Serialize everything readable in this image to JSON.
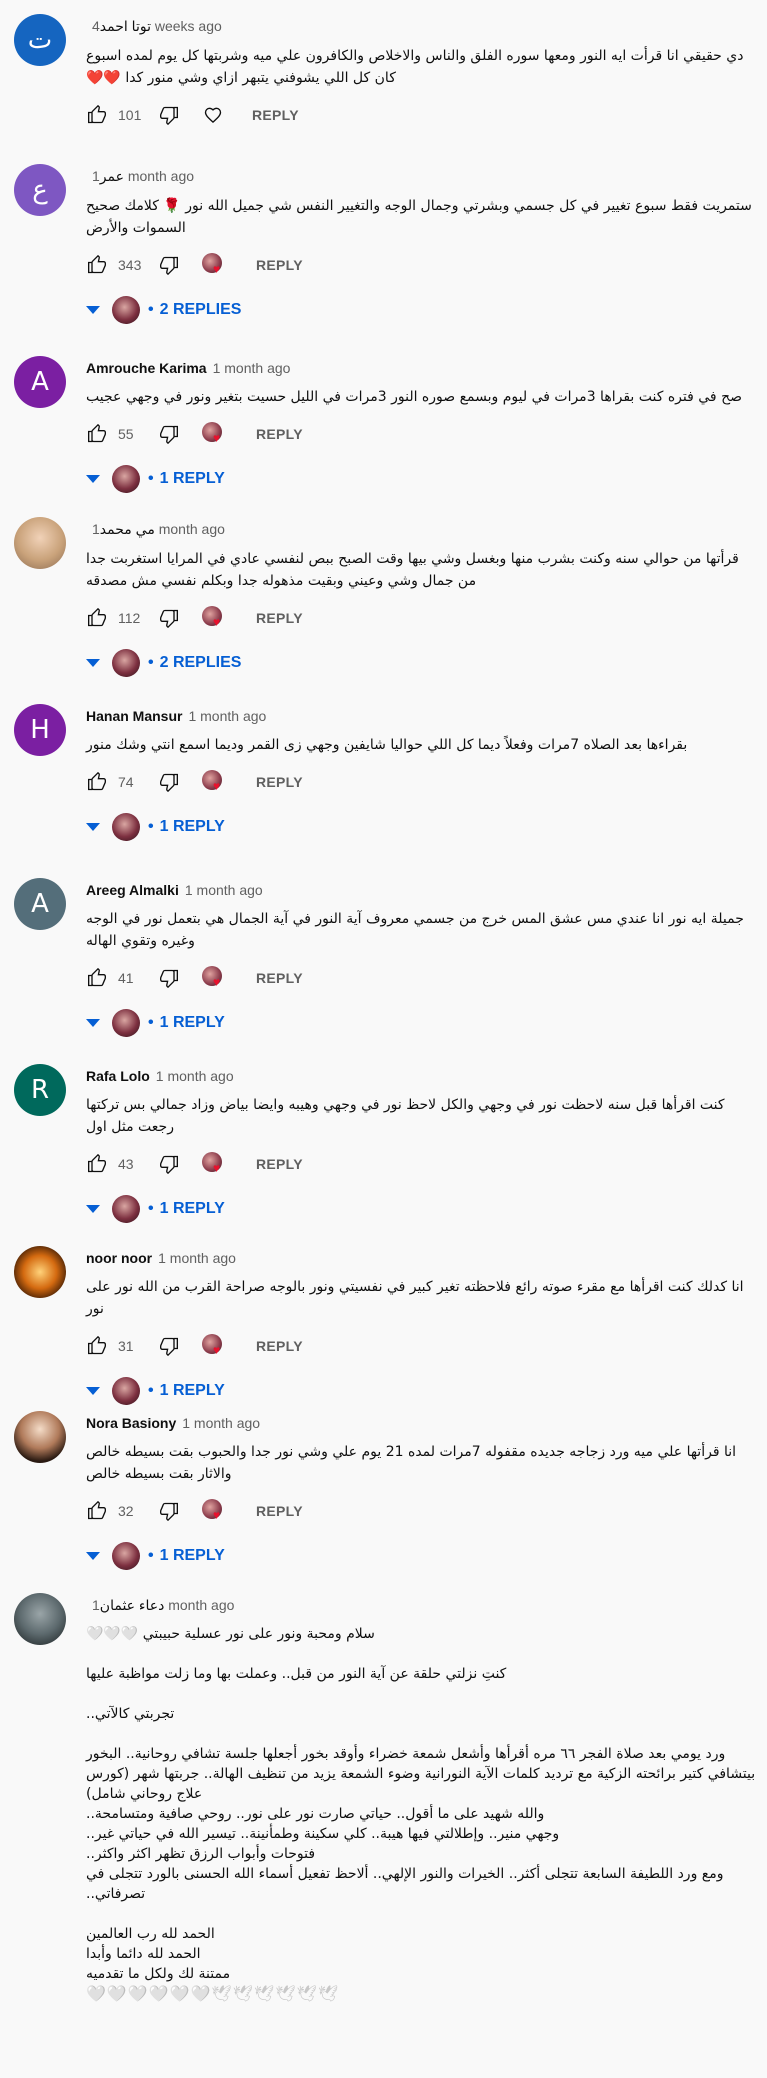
{
  "labels": {
    "reply": "REPLY"
  },
  "colors": {
    "link_blue": "#065fd4",
    "heart_red": "#e8112d",
    "meta_gray": "#606060"
  },
  "comments": [
    {
      "author": "توتا احمد",
      "time": "4 weeks ago",
      "avatar_letter": "ت",
      "avatar_color": "#1565c0",
      "text": "دي حقيقي انا قرأت ايه النور ومعها سوره الفلق والناس والاخلاص والكافرون علي ميه وشربتها كل يوم لمده اسبوع كان كل اللي يشوفني يتبهر ازاي وشي منور كدا ❤️❤️",
      "likes": "101",
      "creator_heart": false,
      "replies": ""
    },
    {
      "author": "عمر",
      "time": "1 month ago",
      "avatar_letter": "ع",
      "avatar_color": "#7e57c2",
      "text": "ستمريت فقط سبوع تغيير في كل جسمي وبشرتي وجمال الوجه والتغيير النفس شي جميل الله نور 🌹 كلامك صحيح السموات والأرض",
      "likes": "343",
      "creator_heart": true,
      "replies": "2 REPLIES"
    },
    {
      "author": "Amrouche Karima",
      "time": "1 month ago",
      "avatar_letter": "A",
      "avatar_color": "#7b1fa2",
      "text": "صح في فتره كنت بقراها 3مرات في ليوم وبسمع صوره النور 3مرات في الليل حسيت بتغير ونور في وجهي عجيب",
      "likes": "55",
      "creator_heart": true,
      "replies": "1 REPLY"
    },
    {
      "author": "مي محمد",
      "time": "1 month ago",
      "avatar_letter": "",
      "avatar_color": "#c9a27a",
      "text": "قرأتها من حوالي سنه وكنت بشرب منها وبغسل وشي بيها وقت الصبح ببص لنفسي عادي في المرايا استغربت جدا من جمال وشي وعيني وبقيت مذهوله جدا وبكلم نفسي مش مصدقه",
      "likes": "112",
      "creator_heart": true,
      "replies": "2 REPLIES"
    },
    {
      "author": "Hanan Mansur",
      "time": "1 month ago",
      "avatar_letter": "H",
      "avatar_color": "#7b1fa2",
      "text": "بقراءها بعد الصلاه 7مرات وفعلاً ديما كل اللي حواليا شايفين وجهي زى القمر وديما اسمع انتي وشك منور",
      "likes": "74",
      "creator_heart": true,
      "replies": "1 REPLY"
    },
    {
      "author": "Areeg Almalki",
      "time": "1 month ago",
      "avatar_letter": "A",
      "avatar_color": "#546e7a",
      "text": "جميلة ايه نور انا عندي مس عشق المس خرج من جسمي  معروف آية النور في آية الجمال هي بتعمل نور في الوجه وغيره وتقوي الهاله",
      "likes": "41",
      "creator_heart": true,
      "replies": "1 REPLY"
    },
    {
      "author": "Rafa Lolo",
      "time": "1 month ago",
      "avatar_letter": "R",
      "avatar_color": "#00695c",
      "text": "كنت اقرأها قبل سنه لاحظت نور في وجهي والكل لاحظ نور في وجهي وهيبه وايضا بياض وزاد جمالي بس تركتها رجعت مثل اول",
      "likes": "43",
      "creator_heart": true,
      "replies": "1 REPLY"
    },
    {
      "author": "noor noor",
      "time": "1 month ago",
      "avatar_letter": "",
      "avatar_color": "#c0601a",
      "text": "انا كدلك كنت اقرأها مع مقرء صوته رائع فلاحظته تغير كبير في نفسيتي ونور بالوجه صراحة القرب من الله نور على نور",
      "likes": "31",
      "creator_heart": true,
      "replies": "1 REPLY"
    },
    {
      "author": "Nora Basiony",
      "time": "1 month ago",
      "avatar_letter": "",
      "avatar_color": "#e8c9b0",
      "text": "انا قرأتها علي ميه ورد زجاجه جديده مقفوله 7مرات لمده 21 يوم علي وشي نور جدا والحبوب بقت بسيطه خالص والاثار بقت بسيطه خالص",
      "likes": "32",
      "creator_heart": true,
      "replies": "1 REPLY"
    },
    {
      "author": "دعاء عثمان",
      "time": "1 month ago",
      "avatar_letter": "",
      "avatar_color": "#5d6a6e",
      "paragraphs": [
        "سلام ومحبة ونور على نور عسلية حبيبتي 🤍🤍🤍",
        "",
        "كنتِ نزلتي حلقة عن آية النور من قبل.. وعملت بها وما زلت مواظبة عليها",
        "",
        "تجربتي كالآتي..",
        "",
        "ورد يومي بعد صلاة الفجر ٦٦ مره  أقرأها وأشعل شمعة خضراء وأوقد بخور أجعلها جلسة تشافي روحانية.. البخور بيتشافي كتير برائحته الزكية مع ترديد كلمات الآية النورانية وضوء الشمعة يزيد من تنظيف الهالة.. جربتها شهر  (كورس علاج روحاني شامل)",
        "والله شهيد على ما أقول.. حياتي صارت نور على نور.. روحي صافية ومتسامحة..",
        "وجهي منير.. وإطلالتي فيها هيبة.. كلي سكينة وطمأنينة.. تيسير الله في حياتي غير..",
        "فتوحات وأبواب الرزق تظهر اكثر واكثر..",
        "ومع ورد اللطيفة السابعة تتجلى أكثر.. الخيرات والنور الإلهي.. ألاحظ تفعيل أسماء الله الحسنى بالورد تتجلى في تصرفاتي..",
        "",
        "الحمد لله رب العالمين",
        "الحمد لله دائما وأبدا",
        "ممتنة لك ولكل ما تقدميه",
        "🤍🤍🤍🤍🤍🤍🕊🕊🕊🕊🕊🕊"
      ],
      "likes": "",
      "creator_heart": false,
      "replies": ""
    }
  ]
}
